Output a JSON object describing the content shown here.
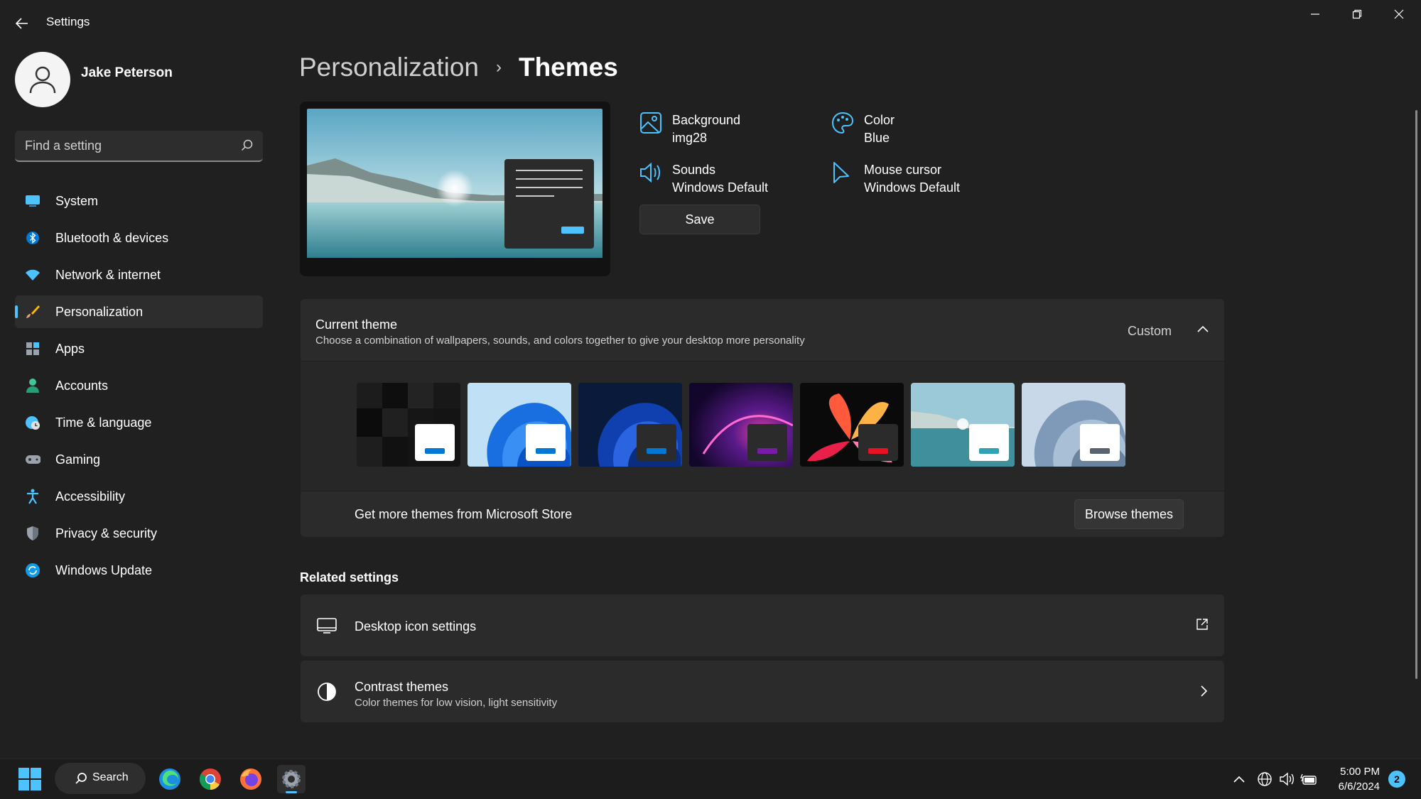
{
  "window": {
    "title": "Settings"
  },
  "profile": {
    "name": "Jake Peterson"
  },
  "search": {
    "placeholder": "Find a setting"
  },
  "sidebar": {
    "items": [
      {
        "label": "System",
        "icon": "monitor-icon",
        "active": false
      },
      {
        "label": "Bluetooth & devices",
        "icon": "bluetooth-icon",
        "active": false
      },
      {
        "label": "Network & internet",
        "icon": "wifi-icon",
        "active": false
      },
      {
        "label": "Personalization",
        "icon": "brush-icon",
        "active": true
      },
      {
        "label": "Apps",
        "icon": "apps-icon",
        "active": false
      },
      {
        "label": "Accounts",
        "icon": "person-icon",
        "active": false
      },
      {
        "label": "Time & language",
        "icon": "globe-clock-icon",
        "active": false
      },
      {
        "label": "Gaming",
        "icon": "gamepad-icon",
        "active": false
      },
      {
        "label": "Accessibility",
        "icon": "accessibility-icon",
        "active": false
      },
      {
        "label": "Privacy & security",
        "icon": "shield-icon",
        "active": false
      },
      {
        "label": "Windows Update",
        "icon": "update-icon",
        "active": false
      }
    ]
  },
  "breadcrumb": {
    "parent": "Personalization",
    "separator": "›",
    "current": "Themes"
  },
  "theme_props": {
    "background": {
      "title": "Background",
      "value": "img28"
    },
    "color": {
      "title": "Color",
      "value": "Blue"
    },
    "sounds": {
      "title": "Sounds",
      "value": "Windows Default"
    },
    "cursor": {
      "title": "Mouse cursor",
      "value": "Windows Default"
    },
    "save_label": "Save"
  },
  "current_theme": {
    "title": "Current theme",
    "description": "Choose a combination of wallpapers, sounds, and colors together to give your desktop more personality",
    "value": "Custom",
    "themes": [
      {
        "name": "dark-tiles",
        "accent": "#0078d4",
        "mini_bg": "#ffffff"
      },
      {
        "name": "windows-light",
        "accent": "#0078d4",
        "mini_bg": "#ffffff"
      },
      {
        "name": "windows-dark",
        "accent": "#0078d4",
        "mini_bg": "#2b2b2b"
      },
      {
        "name": "glow",
        "accent": "#7a1aa8",
        "mini_bg": "#2b2b2b"
      },
      {
        "name": "captured-motion",
        "accent": "#e81123",
        "mini_bg": "#2b2b2b"
      },
      {
        "name": "sunrise-lake",
        "accent": "#2fa3b5",
        "mini_bg": "#ffffff"
      },
      {
        "name": "flow",
        "accent": "#5a6470",
        "mini_bg": "#ffffff"
      }
    ]
  },
  "store": {
    "label": "Get more themes from Microsoft Store",
    "button": "Browse themes"
  },
  "related": {
    "title": "Related settings",
    "items": [
      {
        "title": "Desktop icon settings",
        "description": ""
      },
      {
        "title": "Contrast themes",
        "description": "Color themes for low vision, light sensitivity"
      }
    ]
  },
  "taskbar": {
    "search_label": "Search",
    "time": "5:00 PM",
    "date": "6/6/2024",
    "notification_count": "2"
  },
  "colors": {
    "accent": "#4cc2ff",
    "background": "#202020",
    "card": "#2b2b2b"
  }
}
